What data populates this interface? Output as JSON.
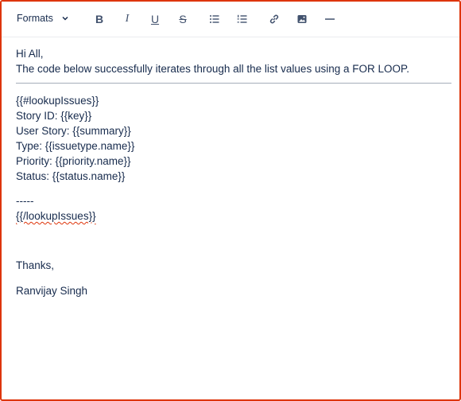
{
  "toolbar": {
    "formats_label": "Formats",
    "buttons": [
      {
        "name": "bold",
        "icon": "bold-icon"
      },
      {
        "name": "italic",
        "icon": "italic-icon"
      },
      {
        "name": "underline",
        "icon": "underline-icon"
      },
      {
        "name": "strikethrough",
        "icon": "strikethrough-icon"
      },
      {
        "name": "bullet-list",
        "icon": "bullet-list-icon"
      },
      {
        "name": "numbered-list",
        "icon": "numbered-list-icon"
      },
      {
        "name": "link",
        "icon": "link-icon"
      },
      {
        "name": "image",
        "icon": "image-icon"
      },
      {
        "name": "horizontal-rule",
        "icon": "horizontal-rule-icon"
      }
    ]
  },
  "content": {
    "greeting": "Hi All,",
    "intro": "The code below successfully iterates through all the list values using a FOR LOOP.",
    "loop_open": "{{#lookupIssues}}",
    "story_id": "Story ID: {{key}}",
    "user_story": "User Story: {{summary}}",
    "type": "Type: {{issuetype.name}}",
    "priority": "Priority: {{priority.name}}",
    "status": "Status: {{status.name}}",
    "separator": "-----",
    "loop_close": "{{/lookupIssues}}",
    "thanks": "Thanks,",
    "signature": "Ranvijay Singh"
  },
  "colors": {
    "border": "#de350b",
    "text": "#172b4d",
    "icon": "#42526e"
  }
}
